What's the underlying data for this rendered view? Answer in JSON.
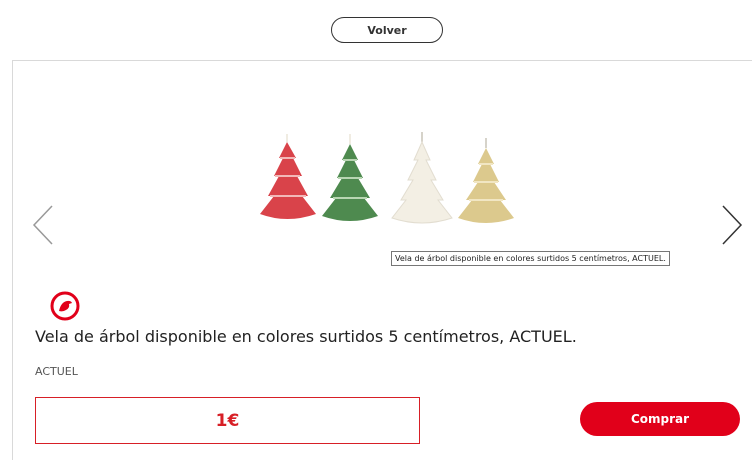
{
  "nav": {
    "back_label": "Volver"
  },
  "product": {
    "image_alt": "Vela de árbol disponible en colores surtidos 5 centímetros, ACTUEL.",
    "tooltip": "Vela de árbol disponible en colores surtidos 5 centímetros, ACTUEL.",
    "title": "Vela de árbol disponible en colores surtidos 5 centímetros, ACTUEL.",
    "brand": "ACTUEL",
    "price": "1€",
    "buy_label": "Comprar",
    "candle_colors": [
      "#d9434a",
      "#4e8a4f",
      "#f3efe4",
      "#dcc98d"
    ]
  },
  "colors": {
    "accent": "#e1001a",
    "price": "#d71f26"
  },
  "icons": [
    "chevron-left-icon",
    "chevron-right-icon",
    "brand-logo-icon"
  ]
}
